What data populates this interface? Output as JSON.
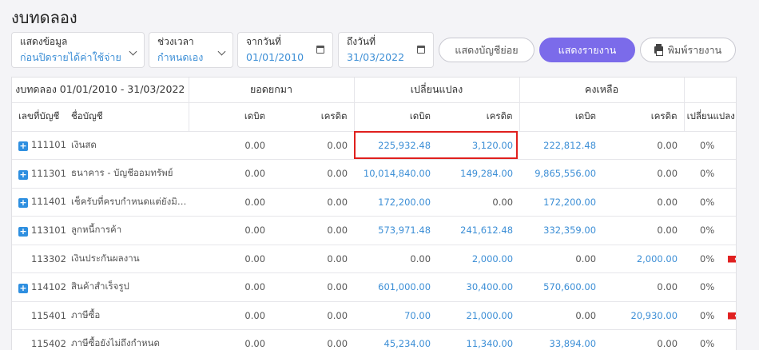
{
  "page": {
    "title": "งบทดลอง"
  },
  "filters": {
    "display": {
      "label": "แสดงข้อมูล",
      "value": "ก่อนปิดรายได้ค่าใช้จ่าย"
    },
    "period": {
      "label": "ช่วงเวลา",
      "value": "กำหนดเอง"
    },
    "from": {
      "label": "จากวันที่",
      "value": "01/01/2010"
    },
    "to": {
      "label": "ถึงวันที่",
      "value": "31/03/2022"
    }
  },
  "buttons": {
    "subaccounts": "แสดงบัญชีย่อย",
    "report": "แสดงรายงาน",
    "print": "พิมพ์รายงาน"
  },
  "table": {
    "group_headers": {
      "title": "งบทดลอง 01/01/2010 - 31/03/2022",
      "brought_forward": "ยอดยกมา",
      "change": "เปลี่ยนแปลง",
      "remaining": "คงเหลือ"
    },
    "columns": {
      "account_no": "เลขที่บัญชี",
      "account_name": "ชื่อบัญชี",
      "debit": "เดบิต",
      "credit": "เครดิต",
      "change_pct": "เปลี่ยนแปลง"
    },
    "rows": [
      {
        "expandable": true,
        "code": "111101",
        "name": "เงินสด",
        "bf_debit": "0.00",
        "bf_credit": "0.00",
        "ch_debit": "225,932.48",
        "ch_credit": "3,120.00",
        "rem_debit": "222,812.48",
        "rem_credit": "0.00",
        "pct": "0%",
        "flag": false
      },
      {
        "expandable": true,
        "code": "111301",
        "name": "ธนาคาร - บัญชีออมทรัพย์",
        "bf_debit": "0.00",
        "bf_credit": "0.00",
        "ch_debit": "10,014,840.00",
        "ch_credit": "149,284.00",
        "rem_debit": "9,865,556.00",
        "rem_credit": "0.00",
        "pct": "0%",
        "flag": false
      },
      {
        "expandable": true,
        "code": "111401",
        "name": "เช็ครับที่ครบกำหนดแต่ยังมิได้ฝ...",
        "bf_debit": "0.00",
        "bf_credit": "0.00",
        "ch_debit": "172,200.00",
        "ch_credit": "0.00",
        "rem_debit": "172,200.00",
        "rem_credit": "0.00",
        "pct": "0%",
        "flag": false
      },
      {
        "expandable": true,
        "code": "113101",
        "name": "ลูกหนี้การค้า",
        "bf_debit": "0.00",
        "bf_credit": "0.00",
        "ch_debit": "573,971.48",
        "ch_credit": "241,612.48",
        "rem_debit": "332,359.00",
        "rem_credit": "0.00",
        "pct": "0%",
        "flag": false
      },
      {
        "expandable": false,
        "code": "113302",
        "name": "เงินประกันผลงาน",
        "bf_debit": "0.00",
        "bf_credit": "0.00",
        "ch_debit": "0.00",
        "ch_credit": "2,000.00",
        "rem_debit": "0.00",
        "rem_credit": "2,000.00",
        "pct": "0%",
        "flag": true
      },
      {
        "expandable": true,
        "code": "114102",
        "name": "สินค้าสำเร็จรูป",
        "bf_debit": "0.00",
        "bf_credit": "0.00",
        "ch_debit": "601,000.00",
        "ch_credit": "30,400.00",
        "rem_debit": "570,600.00",
        "rem_credit": "0.00",
        "pct": "0%",
        "flag": false
      },
      {
        "expandable": false,
        "code": "115401",
        "name": "ภาษีซื้อ",
        "bf_debit": "0.00",
        "bf_credit": "0.00",
        "ch_debit": "70.00",
        "ch_credit": "21,000.00",
        "rem_debit": "0.00",
        "rem_credit": "20,930.00",
        "pct": "0%",
        "flag": true
      },
      {
        "expandable": false,
        "code": "115402",
        "name": "ภาษีซื้อยังไม่ถึงกำหนด",
        "bf_debit": "0.00",
        "bf_credit": "0.00",
        "ch_debit": "45,234.00",
        "ch_credit": "11,340.00",
        "rem_debit": "33,894.00",
        "rem_credit": "0.00",
        "pct": "0%",
        "flag": false
      }
    ]
  },
  "colors": {
    "accent": "#7b6bea",
    "link": "#3d8fd6",
    "highlight": "#e0201e",
    "flag": "#e02020"
  }
}
